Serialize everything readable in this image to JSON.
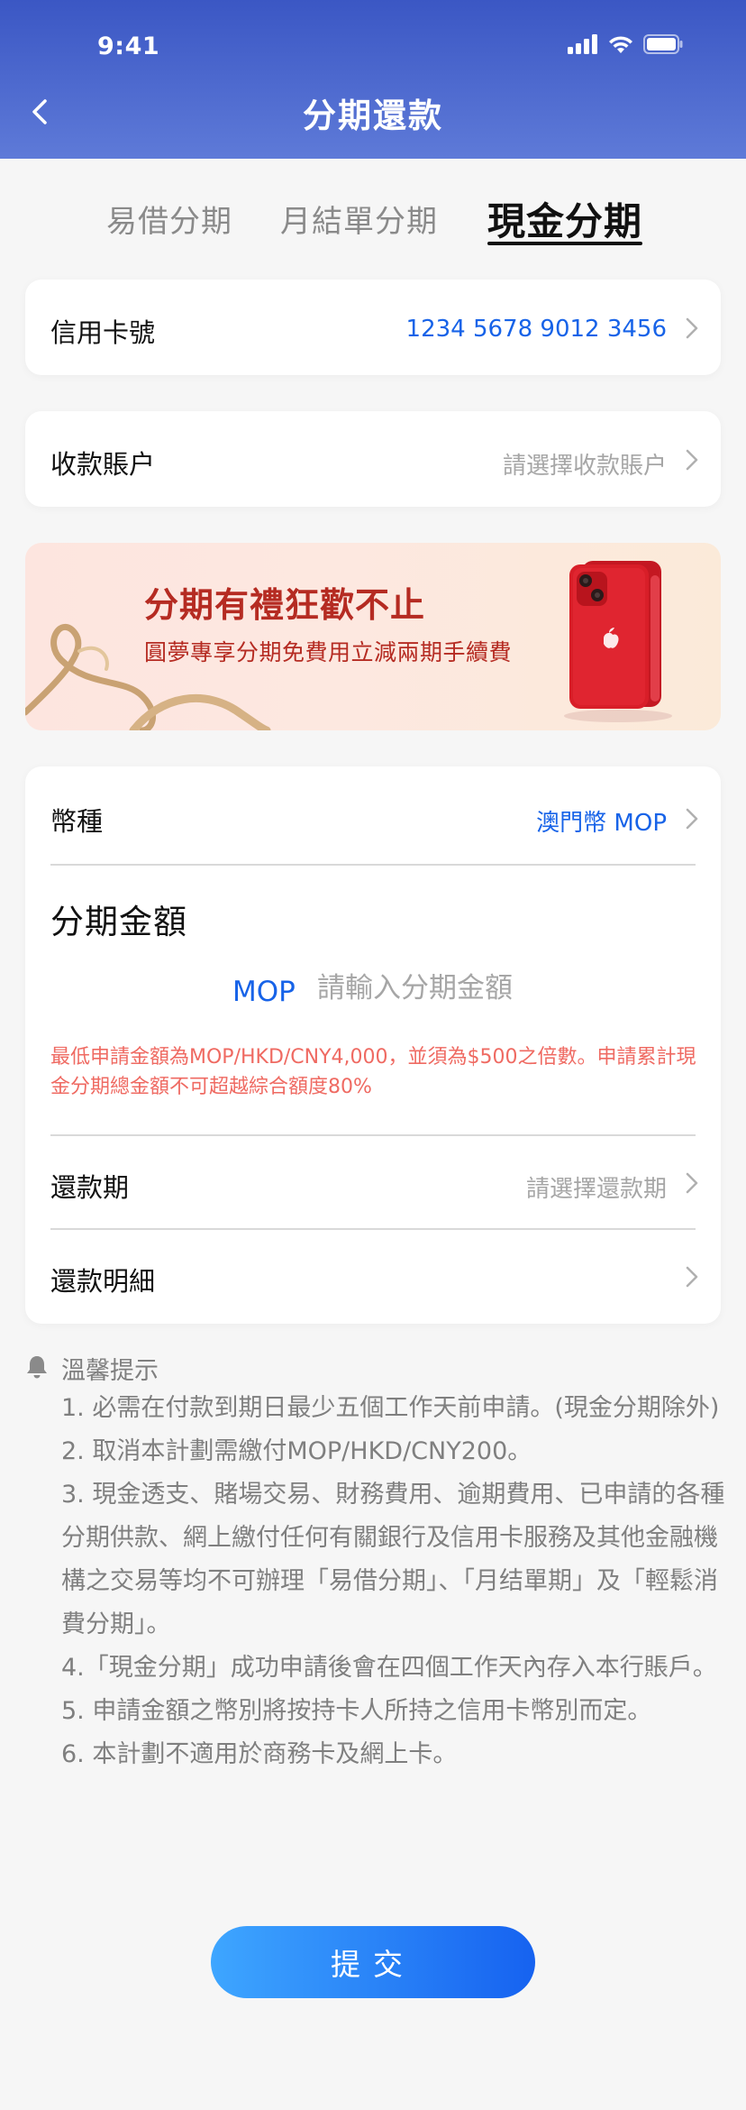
{
  "status": {
    "time": "9:41"
  },
  "nav": {
    "title": "分期還款"
  },
  "tabs": [
    {
      "label": "易借分期",
      "active": false
    },
    {
      "label": "月結單分期",
      "active": false
    },
    {
      "label": "現金分期",
      "active": true
    }
  ],
  "card_number": {
    "label": "信用卡號",
    "value": "1234 5678 9012 3456"
  },
  "receiving_account": {
    "label": "收款賬户",
    "placeholder": "請選擇收款賬户"
  },
  "banner": {
    "title": "分期有禮狂歡不止",
    "subtitle": "圓夢專享分期免費用立減兩期手續費"
  },
  "form": {
    "currency_label": "幣種",
    "currency_value": "澳門幣 MOP",
    "amount_title": "分期金額",
    "amount_currency": "MOP",
    "amount_placeholder": "請輸入分期金額",
    "amount_note": "最低申請金額為MOP/HKD/CNY4,000，並須為$500之倍數。申請累計現金分期總金額不可超越綜合額度80%",
    "term_label": "還款期",
    "term_placeholder": "請選擇還款期",
    "detail_label": "還款明細"
  },
  "tips": {
    "title": "溫馨提示",
    "items": [
      "  1. 必需在付款到期日最少五個工作天前申請。(現金分期除外)",
      "  2. 取消本計劃需繳付MOP/HKD/CNY200。",
      "  3. 現金透支、賭場交易、財務費用、逾期費用、已申請的各種分期供款、網上繳付任何有關銀行及信用卡服務及其他金融機構之交易等均不可辦理「易借分期」、「月结單期」及「輕鬆消費分期」。",
      "  4.「現金分期」成功申請後會在四個工作天內存入本行賬戶。",
      "  5. 申請金額之幣別將按持卡人所持之信用卡幣別而定。",
      "  6. 本計劃不適用於商務卡及網上卡。"
    ]
  },
  "submit_label": "提交",
  "colors": {
    "header": "#3b57c4",
    "accent": "#1763e8",
    "warning": "#ef6a62",
    "banner_text": "#b52b22"
  }
}
